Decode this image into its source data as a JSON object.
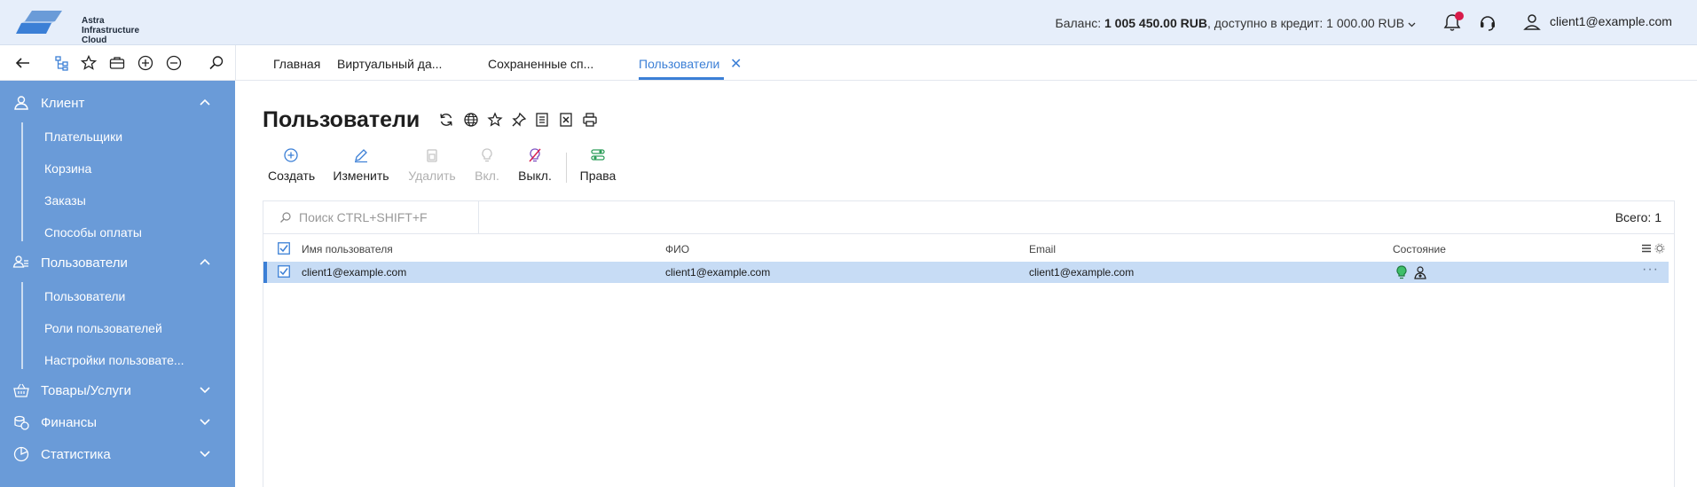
{
  "app": {
    "logo_text": [
      "Astra",
      "Infrastructure",
      "Cloud"
    ],
    "accent_color": "#3b7fd6",
    "sidebar_color": "#6a9bd8",
    "header_color": "#e6eefa"
  },
  "header": {
    "balance_label": "Баланс:",
    "balance_value": "1 005 450.00 RUB",
    "credit_label": "доступно в кредит:",
    "credit_value": "1 000.00 RUB",
    "user_email": "client1@example.com"
  },
  "toolbar": {
    "icons": [
      "back-icon",
      "tree-icon",
      "star-icon",
      "briefcase-icon",
      "plus-circle-icon",
      "minus-circle-icon",
      "search-icon"
    ],
    "tabs": [
      {
        "label": "Главная"
      },
      {
        "label": "Виртуальный да..."
      },
      {
        "label": "Сохраненные сп..."
      },
      {
        "label": "Пользователи",
        "active": true
      }
    ]
  },
  "sidebar": {
    "groups": [
      {
        "label": "Клиент",
        "icon": "client-icon",
        "expanded": true,
        "items": [
          "Плательщики",
          "Корзина",
          "Заказы",
          "Способы оплаты"
        ]
      },
      {
        "label": "Пользователи",
        "icon": "users-icon",
        "expanded": true,
        "items": [
          "Пользователи",
          "Роли пользователей",
          "Настройки пользовате..."
        ]
      },
      {
        "label": "Товары/Услуги",
        "icon": "basket-icon",
        "expanded": false,
        "items": []
      },
      {
        "label": "Финансы",
        "icon": "coins-icon",
        "expanded": false,
        "items": []
      },
      {
        "label": "Статистика",
        "icon": "pie-icon",
        "expanded": false,
        "items": []
      }
    ]
  },
  "main": {
    "title": "Пользователи",
    "title_icons": [
      "refresh-icon",
      "globe-icon",
      "star-icon",
      "pin-icon",
      "document-icon",
      "excel-icon",
      "print-icon"
    ],
    "actions": [
      {
        "label": "Создать",
        "icon": "plus-circle-icon",
        "enabled": true
      },
      {
        "label": "Изменить",
        "icon": "pencil-icon",
        "enabled": true
      },
      {
        "label": "Удалить",
        "icon": "trash-icon",
        "enabled": false
      },
      {
        "label": "Вкл.",
        "icon": "bulb-on-icon",
        "enabled": false
      },
      {
        "label": "Выкл.",
        "icon": "bulb-off-icon",
        "enabled": true
      },
      {
        "label": "Права",
        "icon": "permissions-icon",
        "enabled": true
      }
    ],
    "search_placeholder": "Поиск CTRL+SHIFT+F",
    "total_label": "Всего: 1",
    "columns": [
      "Имя пользователя",
      "ФИО",
      "Email",
      "Состояние"
    ],
    "rows": [
      {
        "username": "client1@example.com",
        "fio": "client1@example.com",
        "email": "client1@example.com",
        "checked": true,
        "status_icons": [
          "active-status-icon",
          "user-role-icon"
        ]
      }
    ]
  }
}
